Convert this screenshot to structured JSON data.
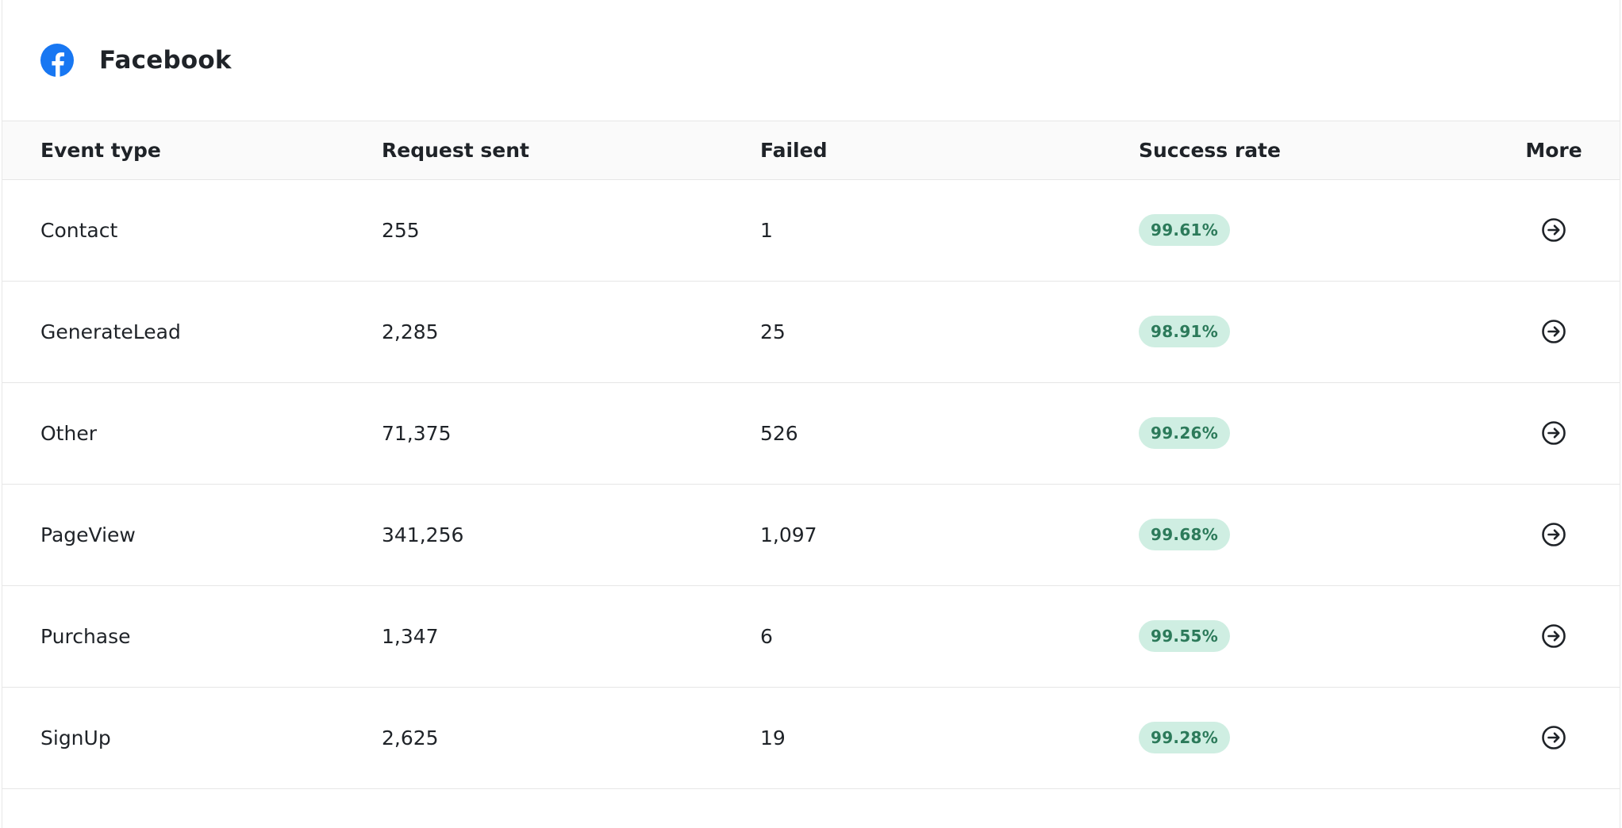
{
  "header": {
    "title": "Facebook",
    "logo_icon": "facebook-icon",
    "logo_color": "#1877F2"
  },
  "table": {
    "columns": [
      "Event type",
      "Request sent",
      "Failed",
      "Success rate",
      "More"
    ],
    "rows": [
      {
        "event_type": "Contact",
        "request_sent": "255",
        "failed": "1",
        "success_rate": "99.61%"
      },
      {
        "event_type": "GenerateLead",
        "request_sent": "2,285",
        "failed": "25",
        "success_rate": "98.91%"
      },
      {
        "event_type": "Other",
        "request_sent": "71,375",
        "failed": "526",
        "success_rate": "99.26%"
      },
      {
        "event_type": "PageView",
        "request_sent": "341,256",
        "failed": "1,097",
        "success_rate": "99.68%"
      },
      {
        "event_type": "Purchase",
        "request_sent": "1,347",
        "failed": "6",
        "success_rate": "99.55%"
      },
      {
        "event_type": "SignUp",
        "request_sent": "2,625",
        "failed": "19",
        "success_rate": "99.28%"
      }
    ],
    "more_icon": "arrow-right-circle-icon"
  },
  "colors": {
    "badge_bg": "#cfeee2",
    "badge_text": "#2c7a5a",
    "header_row_bg": "#fafafa",
    "border": "#e6e6e6"
  }
}
